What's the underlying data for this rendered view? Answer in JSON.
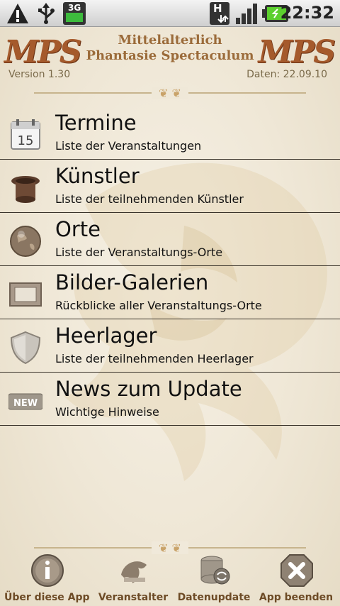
{
  "status_bar": {
    "time": "22:32",
    "network_label": "3G",
    "hspa_label": "H"
  },
  "header": {
    "logo_left": "MPS",
    "logo_right": "MPS",
    "title_line1": "Mittelalterlich",
    "title_line2": "Phantasie Spectaculum",
    "version": "Version 1.30",
    "daten": "Daten: 22.09.10"
  },
  "calendar_day": "15",
  "menu": {
    "items": [
      {
        "title": "Termine",
        "subtitle": "Liste der Veranstaltungen"
      },
      {
        "title": "Künstler",
        "subtitle": "Liste der teilnehmenden Künstler"
      },
      {
        "title": "Orte",
        "subtitle": "Liste der Veranstaltungs-Orte"
      },
      {
        "title": "Bilder-Galerien",
        "subtitle": "Rückblicke aller Veranstaltungs-Orte"
      },
      {
        "title": "Heerlager",
        "subtitle": "Liste der teilnehmenden Heerlager"
      },
      {
        "title": "News zum Update",
        "subtitle": "Wichtige Hinweise"
      }
    ]
  },
  "news_badge": "NEW",
  "footer": {
    "about_label": "Über diese App",
    "organizer_label": "Veranstalter",
    "dataupdate_label": "Datenupdate",
    "exit_label": "App beenden"
  },
  "colors": {
    "accent_brown": "#a55a2c",
    "parchment": "#f1ebdc",
    "footer_text": "#6d4b26"
  }
}
